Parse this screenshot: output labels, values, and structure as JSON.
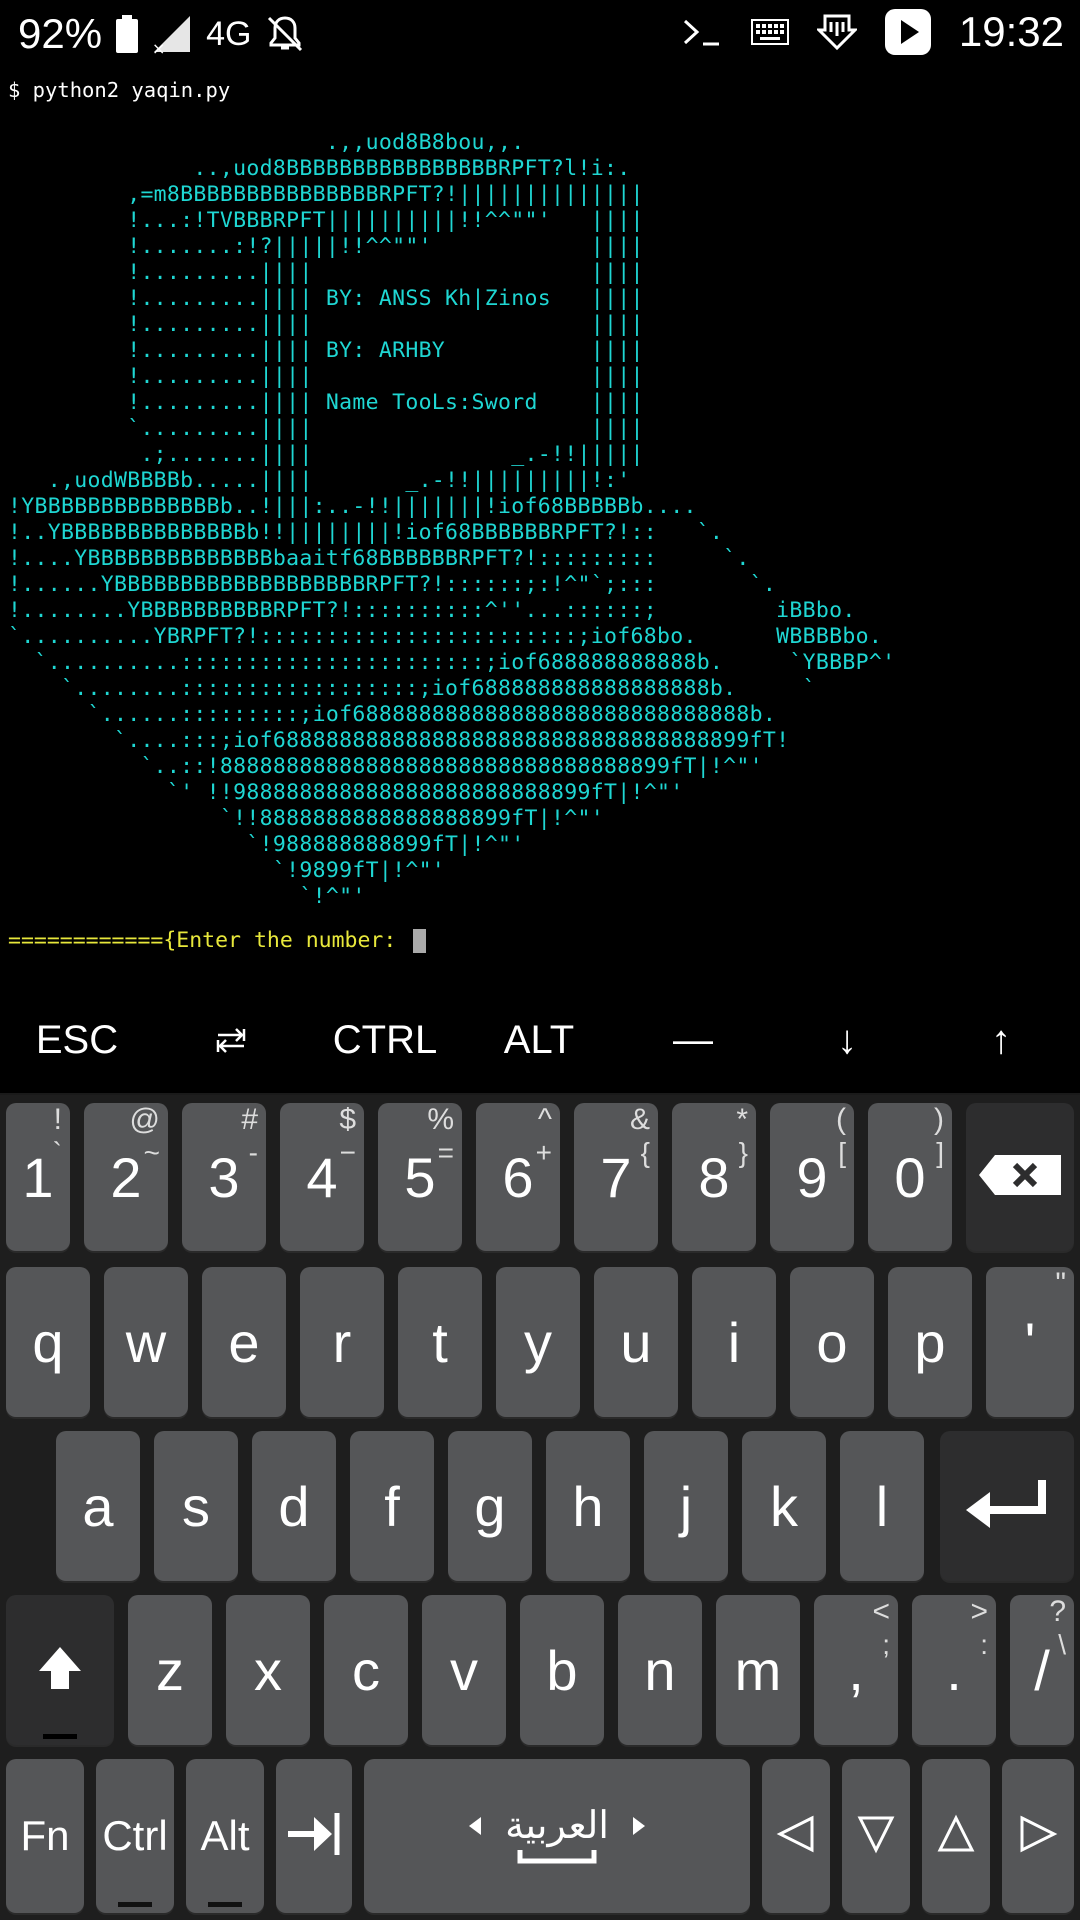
{
  "status_bar": {
    "battery": "92%",
    "network": "4G",
    "time": "19:32",
    "icons": [
      "battery-icon",
      "no-signal-icon",
      "mute-icon",
      "terminal-icon",
      "keyboard-icon",
      "download-icon",
      "play-store-icon"
    ]
  },
  "terminal": {
    "command": "$ python2 yaqin.py",
    "ascii_art": "                        .,,uod8B8bou,,.\n              ..,uod8BBBBBBBBBBBBBBBBRPFT?l!i:.\n         ,=m8BBBBBBBBBBBBBBBRPFT?!||||||||||||||\n         !...:!TVBBBRPFT||||||||||!!^^\"\"'   ||||\n         !.......:!?|||||!!^^\"\"'            ||||\n         !.........||||                     ||||\n         !.........|||| BY: ANSS Kh|Zinos   ||||\n         !.........||||                     ||||\n         !.........|||| BY: ARHBY           ||||\n         !.........||||                     ||||\n         !.........|||| Name TooLs:Sword    ||||\n         `.........||||                     ||||\n          .;.......||||               _.-!!|||||\n   .,uodWBBBBb.....||||       _.-!!|||||||||!:'\n!YBBBBBBBBBBBBBBb..!|||:..-!!|||||||!iof68BBBBBb....\n!..YBBBBBBBBBBBBBBb!!||||||||!iof68BBBBBBRPFT?!::   `.\n!....YBBBBBBBBBBBBBBbaaitf68BBBBBBRPFT?!:::::::::     `.\n!......YBBBBBBBBBBBBBBBBBBBRPFT?!::::::;:!^\"`;:::       `.\n!........YBBBBBBBBBBRPFT?!::::::::::^''...::::::;         iBBbo.\n`..........YBRPFT?!::::::::::::::::::::::::;iof68bo.      WBBBBbo.\n  `..........:::::::::::::::::::::::;iof688888888888b.     `YBBBP^'\n    `........::::::::::::::::::;iof688888888888888888b.     `\n      `......:::::::::;iof688888888888888888888888888888b.\n        `....:::;iof688888888888888888888888888888888899fT!\n          `..::!8888888888888888888888888888888899fT|!^\"'\n            `' !!988888888888888888888888899fT|!^\"'\n                `!!8888888888888888899fT|!^\"'\n                  `!988888888899fT|!^\"'\n                    `!9899fT|!^\"'\n                      `!^\"'",
    "prompt": "============{Enter the number: "
  },
  "extra_keys": [
    "ESC",
    "⭾",
    "CTRL",
    "ALT",
    "—",
    "↓",
    "↑"
  ],
  "keyboard": {
    "number_row": [
      {
        "main": "1",
        "sym": "!",
        "sym2": "`"
      },
      {
        "main": "2",
        "sym": "@",
        "sym2": "~"
      },
      {
        "main": "3",
        "sym": "#",
        "sym2": "-"
      },
      {
        "main": "4",
        "sym": "$",
        "sym2": "−"
      },
      {
        "main": "5",
        "sym": "%",
        "sym2": "="
      },
      {
        "main": "6",
        "sym": "^",
        "sym2": "+"
      },
      {
        "main": "7",
        "sym": "&",
        "sym2": "{"
      },
      {
        "main": "8",
        "sym": "*",
        "sym2": "}"
      },
      {
        "main": "9",
        "sym": "(",
        "sym2": "["
      },
      {
        "main": "0",
        "sym": ")",
        "sym2": "]"
      }
    ],
    "row_q": [
      "q",
      "w",
      "e",
      "r",
      "t",
      "y",
      "u",
      "i",
      "o",
      "p"
    ],
    "row_q_extra": {
      "main": "'",
      "sym": "\""
    },
    "row_a": [
      "a",
      "s",
      "d",
      "f",
      "g",
      "h",
      "j",
      "k",
      "l"
    ],
    "row_z": [
      "z",
      "x",
      "c",
      "v",
      "b",
      "n",
      "m"
    ],
    "row_z_extra": [
      {
        "main": ",",
        "sym": "<",
        "sym2": ";"
      },
      {
        "main": ".",
        "sym": ">",
        "sym2": ":"
      },
      {
        "main": "/",
        "sym": "?",
        "sym2": "\\"
      }
    ],
    "bottom_row": {
      "fn": "Fn",
      "ctrl": "Ctrl",
      "alt": "Alt",
      "language": "العربية"
    }
  },
  "colors": {
    "art": "#1fd7d3",
    "prompt": "#e8e83b",
    "key": "#555658",
    "key_dark": "#2d2d2e",
    "keyboard_bg": "#1e1e1e"
  }
}
